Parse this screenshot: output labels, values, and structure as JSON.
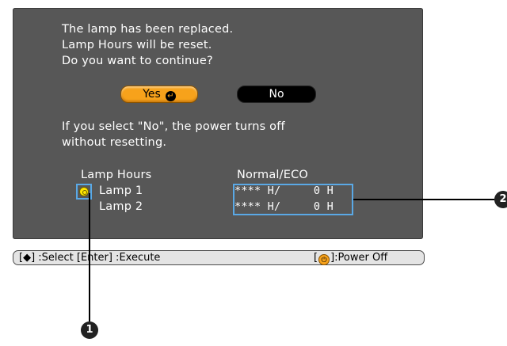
{
  "dialog": {
    "message": [
      "The lamp has been replaced.",
      "Lamp Hours will be reset.",
      "Do you want to continue?"
    ],
    "yes_label": "Yes",
    "no_label": "No",
    "note": [
      "If you select \"No\", the power turns off",
      "without resetting."
    ],
    "lamp_hours_header": "Lamp Hours",
    "mode_header": "Normal/ECO",
    "lamps": [
      {
        "label": "Lamp 1",
        "value": "**** H/     0 H"
      },
      {
        "label": "Lamp 2",
        "value": "**** H/     0 H"
      }
    ]
  },
  "statusbar": {
    "left": "[◆] :Select  [Enter] :Execute",
    "right_prefix": "[",
    "right_suffix": "]:Power Off"
  },
  "callouts": {
    "one": "1",
    "two": "2"
  },
  "colors": {
    "dialog_bg": "#575757",
    "accent": "#f7a21b",
    "highlight": "#5aa9e6"
  }
}
